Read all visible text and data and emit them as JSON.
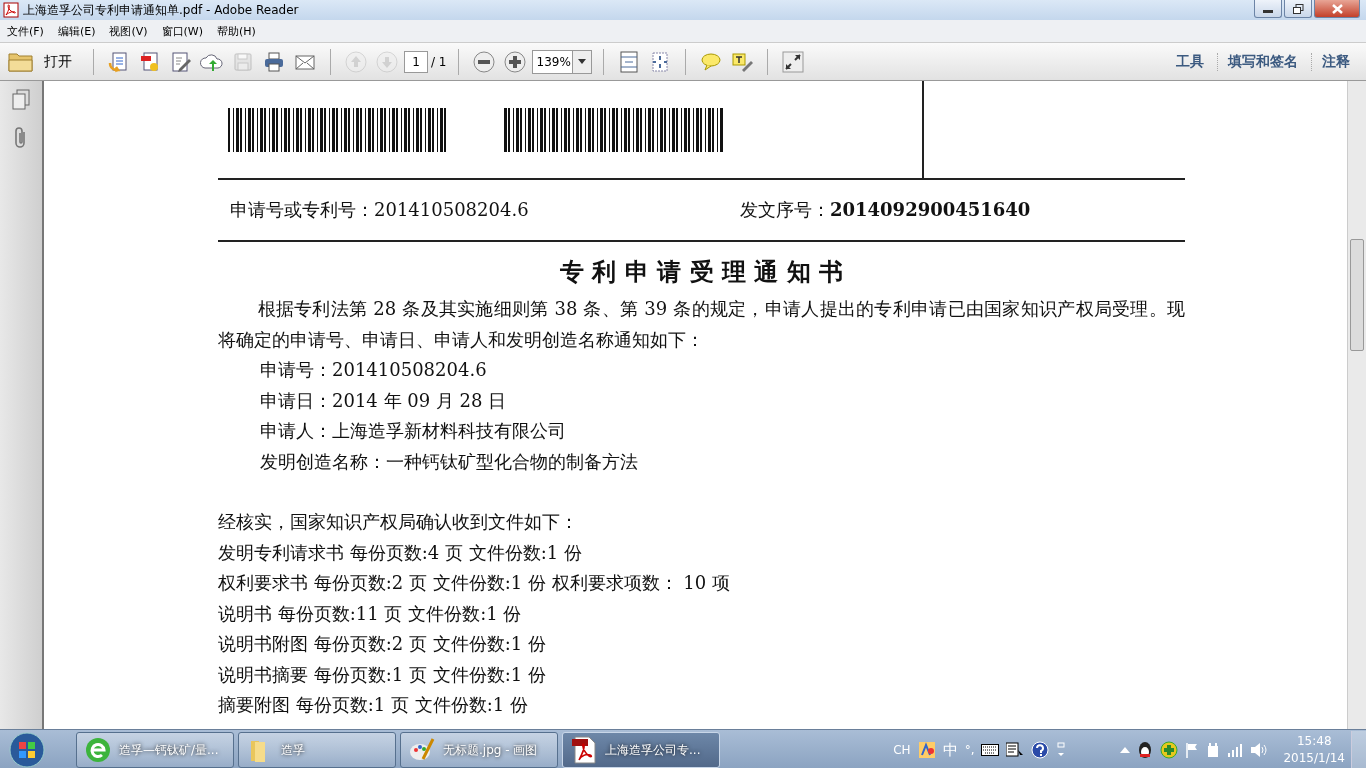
{
  "window": {
    "title": "上海造孚公司专利申请通知单.pdf - Adobe Reader"
  },
  "menu": [
    "文件(F)",
    "编辑(E)",
    "视图(V)",
    "窗口(W)",
    "帮助(H)"
  ],
  "toolbar": {
    "open_label": "打开",
    "buttons": [
      {
        "kind": "create",
        "disabled": false
      },
      {
        "kind": "convert",
        "disabled": false
      },
      {
        "kind": "edit",
        "disabled": false
      },
      {
        "kind": "upload",
        "disabled": false
      },
      {
        "kind": "save",
        "disabled": true
      },
      {
        "kind": "print",
        "disabled": false
      },
      {
        "kind": "mail",
        "disabled": false
      },
      {
        "kind": "sep"
      },
      {
        "kind": "prev",
        "disabled": true
      },
      {
        "kind": "next",
        "disabled": true
      }
    ],
    "page_number": "1",
    "page_total": "/ 1",
    "zoom_buttons": [
      {
        "kind": "zoom_out",
        "disabled": false
      },
      {
        "kind": "zoom_in",
        "disabled": false
      }
    ],
    "zoom": "139%",
    "view_buttons": [
      {
        "kind": "fit_page",
        "disabled": false
      },
      {
        "kind": "fit_width",
        "disabled": false
      },
      {
        "kind": "sep"
      },
      {
        "kind": "comment",
        "disabled": false
      },
      {
        "kind": "highlight",
        "disabled": false
      },
      {
        "kind": "sep"
      },
      {
        "kind": "fullscreen",
        "disabled": false
      }
    ],
    "links": [
      "工具",
      "填写和签名",
      "注释"
    ]
  },
  "document": {
    "application_number": {
      "label": "申请号或专利号：",
      "value": "201410508204.6"
    },
    "serial_number": {
      "label": "发文序号：",
      "value": "2014092900451640"
    },
    "title": "专 利 申 请 受 理 通 知 书",
    "intro": "根据专利法第 28 条及其实施细则第 38 条、第 39 条的规定，申请人提出的专利申请已由国家知识产权局受理。现将确定的申请号、申请日、申请人和发明创造名称通知如下：",
    "details": [
      "申请号：201410508204.6",
      "申请日：2014 年 09 月 28 日",
      "申请人：上海造孚新材料科技有限公司",
      "发明创造名称：一种钙钛矿型化合物的制备方法"
    ],
    "confirmation": "经核实，国家知识产权局确认收到文件如下：",
    "files": [
      "发明专利请求书  每份页数:4 页  文件份数:1 份",
      "权利要求书  每份页数:2 页  文件份数:1 份  权利要求项数：  10 项",
      "说明书  每份页数:11 页  文件份数:1 份",
      "说明书附图  每份页数:2 页  文件份数:1 份",
      "说明书摘要  每份页数:1 页  文件份数:1 份",
      "摘要附图  每份页数:1 页  文件份数:1 份"
    ]
  },
  "taskbar": {
    "tasks": [
      {
        "kind": "browser",
        "label": "造孚—钙钛矿/量...",
        "selected": false
      },
      {
        "kind": "folder",
        "label": "造孚",
        "selected": false
      },
      {
        "kind": "paint",
        "label": "无标题.jpg - 画图",
        "selected": false
      },
      {
        "kind": "pdf",
        "label": "上海造孚公司专...",
        "selected": true
      }
    ],
    "ime": [
      "CH",
      "中",
      "°,"
    ],
    "time": "15:48",
    "date": "2015/1/14"
  }
}
